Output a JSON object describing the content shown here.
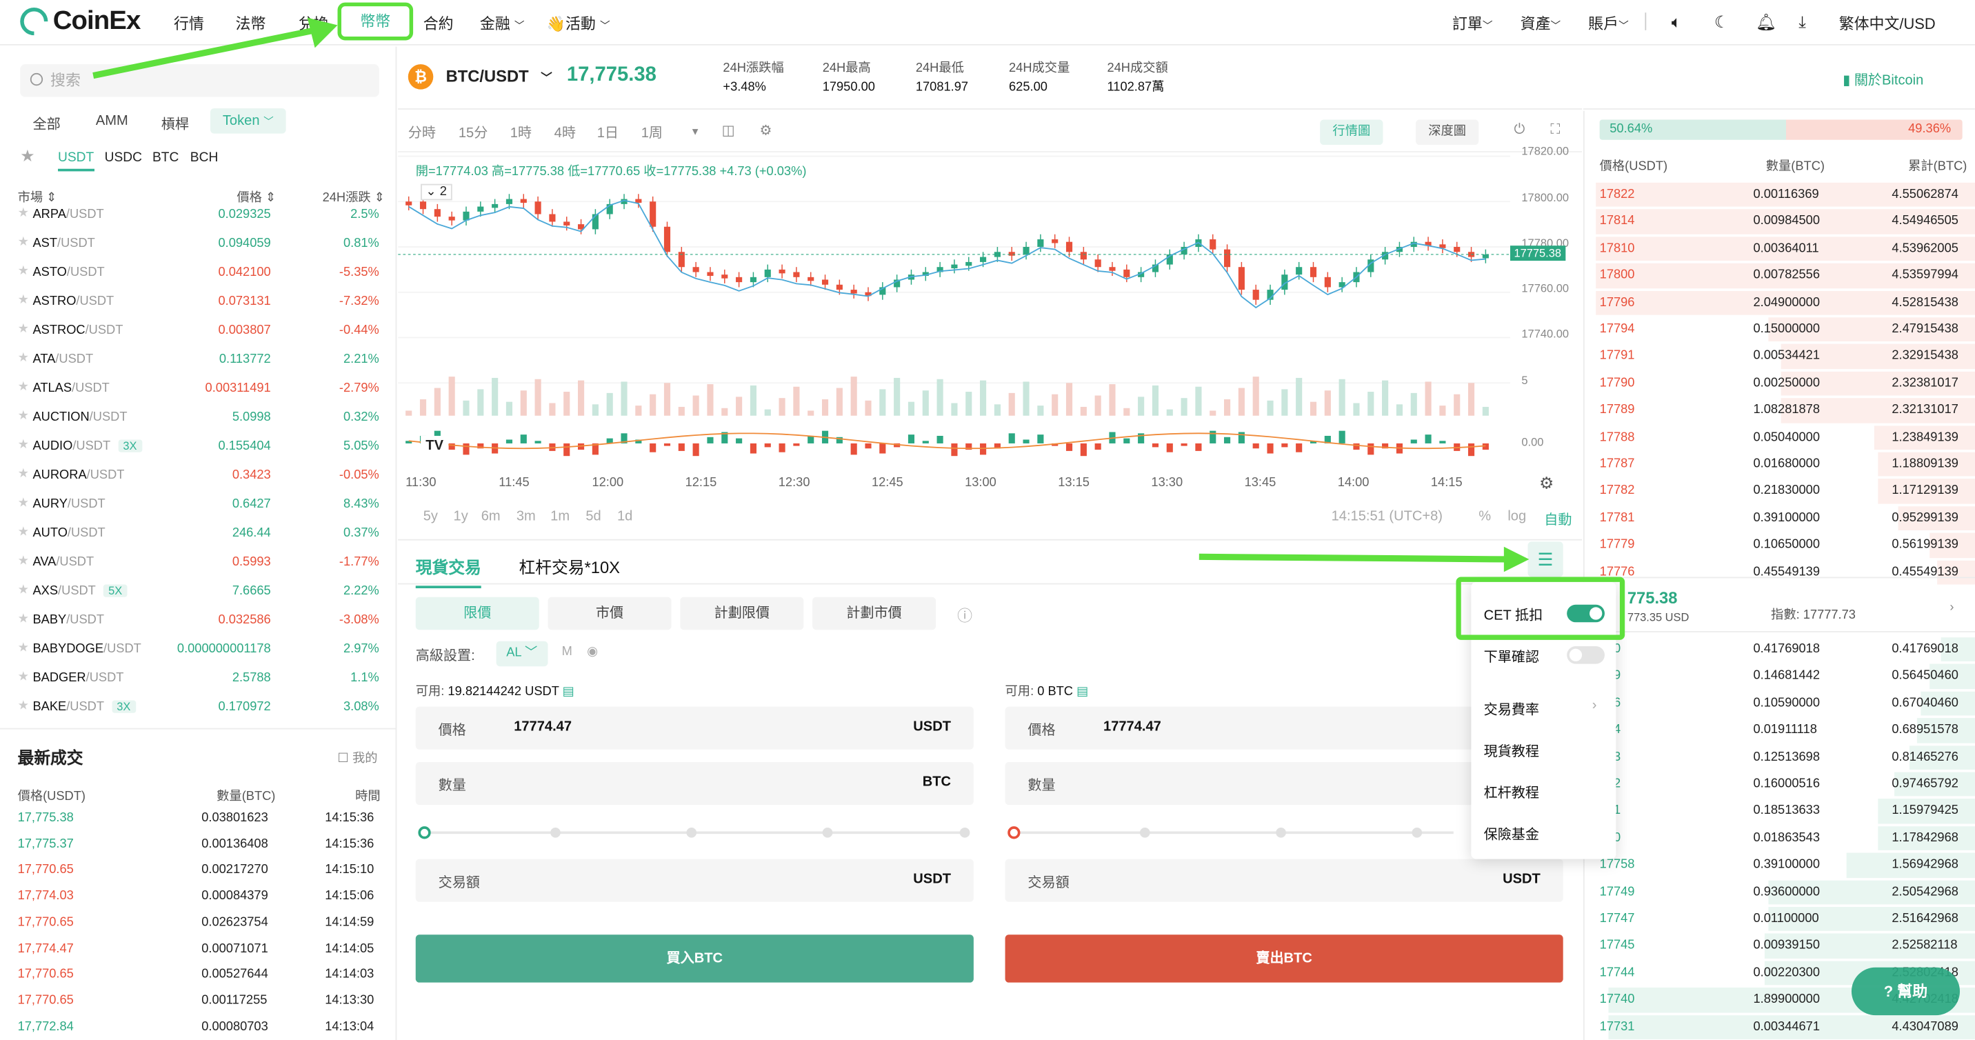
{
  "header": {
    "brand": "CoinEx",
    "nav": [
      "行情",
      "法幣",
      "兌換",
      "幣幣",
      "合約",
      "金融",
      "👋活動"
    ],
    "active": "幣幣",
    "right": [
      "訂單",
      "資產",
      "賬戶",
      "繁体中文/USD"
    ]
  },
  "left": {
    "search_placeholder": "搜索",
    "tabs": [
      "全部",
      "AMM",
      "槓桿",
      "Token"
    ],
    "quote_tabs": [
      "USDT",
      "USDC",
      "BTC",
      "BCH"
    ],
    "col_market": "市場",
    "col_price": "價格",
    "col_change": "24H漲跌",
    "markets": [
      {
        "base": "ARPA",
        "quote": "/USDT",
        "badge": "",
        "price": "0.029325",
        "change": "2.5%",
        "up": true
      },
      {
        "base": "AST",
        "quote": "/USDT",
        "badge": "",
        "price": "0.094059",
        "change": "0.81%",
        "up": true
      },
      {
        "base": "ASTO",
        "quote": "/USDT",
        "badge": "",
        "price": "0.042100",
        "change": "-5.35%",
        "up": false
      },
      {
        "base": "ASTRO",
        "quote": "/USDT",
        "badge": "",
        "price": "0.073131",
        "change": "-7.32%",
        "up": false
      },
      {
        "base": "ASTROC",
        "quote": "/USDT",
        "badge": "",
        "price": "0.003807",
        "change": "-0.44%",
        "up": false
      },
      {
        "base": "ATA",
        "quote": "/USDT",
        "badge": "",
        "price": "0.113772",
        "change": "2.21%",
        "up": true
      },
      {
        "base": "ATLAS",
        "quote": "/USDT",
        "badge": "",
        "price": "0.00311491",
        "change": "-2.79%",
        "up": false
      },
      {
        "base": "AUCTION",
        "quote": "/USDT",
        "badge": "",
        "price": "5.0998",
        "change": "0.32%",
        "up": true
      },
      {
        "base": "AUDIO",
        "quote": "/USDT",
        "badge": "3X",
        "price": "0.155404",
        "change": "5.05%",
        "up": true
      },
      {
        "base": "AURORA",
        "quote": "/USDT",
        "badge": "",
        "price": "0.3423",
        "change": "-0.05%",
        "up": false
      },
      {
        "base": "AURY",
        "quote": "/USDT",
        "badge": "",
        "price": "0.6427",
        "change": "8.43%",
        "up": true
      },
      {
        "base": "AUTO",
        "quote": "/USDT",
        "badge": "",
        "price": "246.44",
        "change": "0.37%",
        "up": true
      },
      {
        "base": "AVA",
        "quote": "/USDT",
        "badge": "",
        "price": "0.5993",
        "change": "-1.77%",
        "up": false
      },
      {
        "base": "AXS",
        "quote": "/USDT",
        "badge": "5X",
        "price": "7.6665",
        "change": "2.22%",
        "up": true
      },
      {
        "base": "BABY",
        "quote": "/USDT",
        "badge": "",
        "price": "0.032586",
        "change": "-3.08%",
        "up": false
      },
      {
        "base": "BABYDOGE",
        "quote": "/USDT",
        "badge": "",
        "price": "0.000000001178",
        "change": "2.97%",
        "up": true
      },
      {
        "base": "BADGER",
        "quote": "/USDT",
        "badge": "",
        "price": "2.5788",
        "change": "1.1%",
        "up": true
      },
      {
        "base": "BAKE",
        "quote": "/USDT",
        "badge": "3X",
        "price": "0.170972",
        "change": "3.08%",
        "up": true
      }
    ],
    "trades_title": "最新成交",
    "trades_mine": "我的",
    "trades_cols": [
      "價格(USDT)",
      "數量(BTC)",
      "時間"
    ],
    "trades": [
      {
        "price": "17,775.38",
        "qty": "0.03801623",
        "time": "14:15:36",
        "up": true
      },
      {
        "price": "17,775.37",
        "qty": "0.00136408",
        "time": "14:15:36",
        "up": true
      },
      {
        "price": "17,770.65",
        "qty": "0.00217270",
        "time": "14:15:10",
        "up": false
      },
      {
        "price": "17,774.03",
        "qty": "0.00084379",
        "time": "14:15:06",
        "up": false
      },
      {
        "price": "17,770.65",
        "qty": "0.02623754",
        "time": "14:14:59",
        "up": false
      },
      {
        "price": "17,774.47",
        "qty": "0.00071071",
        "time": "14:14:05",
        "up": false
      },
      {
        "price": "17,770.65",
        "qty": "0.00527644",
        "time": "14:14:03",
        "up": false
      },
      {
        "price": "17,770.65",
        "qty": "0.00117255",
        "time": "14:13:30",
        "up": false
      },
      {
        "price": "17,772.84",
        "qty": "0.00080703",
        "time": "14:13:04",
        "up": true
      }
    ]
  },
  "ticker": {
    "pair": "BTC/USDT",
    "last": "17,775.38",
    "stats": [
      {
        "label": "24H漲跌幅",
        "value": "+3.48%"
      },
      {
        "label": "24H最高",
        "value": "17950.00"
      },
      {
        "label": "24H最低",
        "value": "17081.97"
      },
      {
        "label": "24H成交量",
        "value": "625.00"
      },
      {
        "label": "24H成交額",
        "value": "1102.87萬"
      }
    ],
    "about": "關於Bitcoin"
  },
  "chart": {
    "intervals": [
      "分時",
      "15分",
      "1時",
      "4時",
      "1日",
      "1周"
    ],
    "views": [
      "行情圖",
      "深度圖"
    ],
    "ohlc": "開=17774.03 高=17775.38 低=17770.65 收=17775.38 +4.73 (+0.03%)",
    "ma_toggle": "2",
    "price_ticks": [
      "17820.00",
      "17800.00",
      "17780.00",
      "17760.00",
      "17740.00"
    ],
    "vol_tick": "5",
    "macd_tick": "0.00",
    "current_price": "17775.38",
    "time_ticks": [
      "11:30",
      "11:45",
      "12:00",
      "12:15",
      "12:30",
      "12:45",
      "13:00",
      "13:15",
      "13:30",
      "13:45",
      "14:00",
      "14:15"
    ],
    "ranges": [
      "5y",
      "1y",
      "6m",
      "3m",
      "1m",
      "5d",
      "1d"
    ],
    "clock": "14:15:51 (UTC+8)",
    "scale_opts": [
      "%",
      "log",
      "自動"
    ],
    "colors": {
      "up": "#2ca882",
      "down": "#e8503a",
      "ma1": "#4aa8d8",
      "ma2": "#f08b3a"
    }
  },
  "form": {
    "tabs": [
      "現貨交易",
      "杠杆交易*10X"
    ],
    "types": [
      "限價",
      "市價",
      "計劃限價",
      "計劃市價"
    ],
    "advanced": "高級設置:",
    "adv_sel": "AL",
    "adv_m": "M",
    "buy": {
      "avail_label": "可用:",
      "avail": "19.82144242 USDT",
      "price_label": "價格",
      "price": "17774.47",
      "price_unit": "USDT",
      "qty_label": "數量",
      "qty_unit": "BTC",
      "total_label": "交易額",
      "total_unit": "USDT",
      "button": "買入BTC"
    },
    "sell": {
      "avail_label": "可用:",
      "avail": "0 BTC",
      "price_label": "價格",
      "price": "17774.47",
      "qty_label": "數量",
      "total_label": "交易額",
      "total_unit": "USDT",
      "button": "賣出BTC"
    }
  },
  "popup": {
    "items": [
      "CET 抵扣",
      "下單確認",
      "交易費率",
      "現貨教程",
      "杠杆教程",
      "保險基金"
    ],
    "cet_on": true
  },
  "book": {
    "buy_pct": "50.64%",
    "sell_pct": "49.36%",
    "cols": [
      "價格(USDT)",
      "數量(BTC)",
      "累計(BTC)"
    ],
    "asks": [
      {
        "p": "17822",
        "q": "0.00116369",
        "c": "4.55062874",
        "d": 0.97
      },
      {
        "p": "17814",
        "q": "0.00984500",
        "c": "4.54946505",
        "d": 0.97
      },
      {
        "p": "17810",
        "q": "0.00364011",
        "c": "4.53962005",
        "d": 0.97
      },
      {
        "p": "17800",
        "q": "0.00782556",
        "c": "4.53597994",
        "d": 0.97
      },
      {
        "p": "17796",
        "q": "2.04900000",
        "c": "4.52815438",
        "d": 0.97
      },
      {
        "p": "17794",
        "q": "0.15000000",
        "c": "2.47915438",
        "d": 0.53
      },
      {
        "p": "17791",
        "q": "0.00534421",
        "c": "2.32915438",
        "d": 0.5
      },
      {
        "p": "17790",
        "q": "0.00250000",
        "c": "2.32381017",
        "d": 0.5
      },
      {
        "p": "17789",
        "q": "1.08281878",
        "c": "2.32131017",
        "d": 0.5
      },
      {
        "p": "17788",
        "q": "0.05040000",
        "c": "1.23849139",
        "d": 0.26
      },
      {
        "p": "17787",
        "q": "0.01680000",
        "c": "1.18809139",
        "d": 0.25
      },
      {
        "p": "17782",
        "q": "0.21830000",
        "c": "1.17129139",
        "d": 0.25
      },
      {
        "p": "17781",
        "q": "0.39100000",
        "c": "0.95299139",
        "d": 0.2
      },
      {
        "p": "17779",
        "q": "0.10650000",
        "c": "0.56199139",
        "d": 0.12
      },
      {
        "p": "17776",
        "q": "0.45549139",
        "c": "0.45549139",
        "d": 0.1
      }
    ],
    "mid_price": "775.38",
    "mid_usd": "773.35 USD",
    "index_label": "指數:",
    "index": "17777.73",
    "bids": [
      {
        "p": "770",
        "q": "0.41769018",
        "c": "0.41769018",
        "d": 0.09
      },
      {
        "p": "769",
        "q": "0.14681442",
        "c": "0.56450460",
        "d": 0.12
      },
      {
        "p": "766",
        "q": "0.10590000",
        "c": "0.67040460",
        "d": 0.14
      },
      {
        "p": "764",
        "q": "0.01911118",
        "c": "0.68951578",
        "d": 0.15
      },
      {
        "p": "763",
        "q": "0.12513698",
        "c": "0.81465276",
        "d": 0.17
      },
      {
        "p": "762",
        "q": "0.16000516",
        "c": "0.97465792",
        "d": 0.21
      },
      {
        "p": "761",
        "q": "0.18513633",
        "c": "1.15979425",
        "d": 0.25
      },
      {
        "p": "760",
        "q": "0.01863543",
        "c": "1.17842968",
        "d": 0.25
      },
      {
        "p": "17758",
        "q": "0.39100000",
        "c": "1.56942968",
        "d": 0.33
      },
      {
        "p": "17749",
        "q": "0.93600000",
        "c": "2.50542968",
        "d": 0.53
      },
      {
        "p": "17747",
        "q": "0.01100000",
        "c": "2.51642968",
        "d": 0.53
      },
      {
        "p": "17745",
        "q": "0.00939150",
        "c": "2.52582118",
        "d": 0.54
      },
      {
        "p": "17744",
        "q": "0.00220300",
        "c": "2.52802418",
        "d": 0.54
      },
      {
        "p": "17740",
        "q": "1.89900000",
        "c": "4.42702418",
        "d": 0.94
      },
      {
        "p": "17731",
        "q": "0.00344671",
        "c": "4.43047089",
        "d": 0.94
      }
    ],
    "help": "幫助"
  }
}
